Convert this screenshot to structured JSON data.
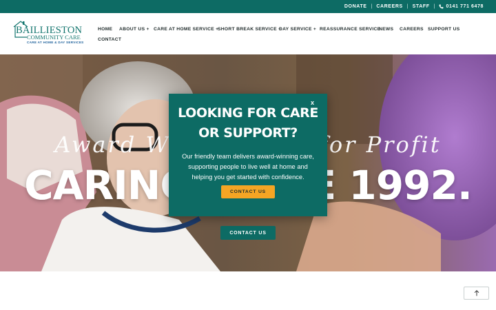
{
  "topbar": {
    "links": [
      "DONATE",
      "CAREERS",
      "STAFF"
    ],
    "phone": "0141 771 6478"
  },
  "logo": {
    "title": "BAILLIESTON",
    "subtitle": "COMMUNITY CARE",
    "tagline": "CARE AT HOME & DAY SERVICES"
  },
  "nav": {
    "items": [
      "HOME",
      "ABOUT US +",
      "CARE AT HOME SERVICE +",
      "SHORT BREAK SERVICE +",
      "DAY SERVICE +",
      "REASSURANCE SERVICE",
      "NEWS",
      "CAREERS",
      "SUPPORT US",
      "CONTACT"
    ]
  },
  "hero": {
    "script_text": "Award Winning Not for Profit",
    "headline": "CARING SINCE 1992.",
    "button_label": "CONTACT US"
  },
  "modal": {
    "close_label": "x",
    "title_line1": "LOOKING FOR CARE",
    "title_line2": "OR SUPPORT?",
    "text": "Our friendly team delivers award-winning care, supporting people to live well at home and helping you get started with confidence.",
    "button_label": "CONTACT US"
  },
  "scroll_top": {
    "icon": "arrow-up-icon"
  },
  "colors": {
    "brand_teal": "#0d6b64",
    "accent_orange": "#f5a524"
  }
}
